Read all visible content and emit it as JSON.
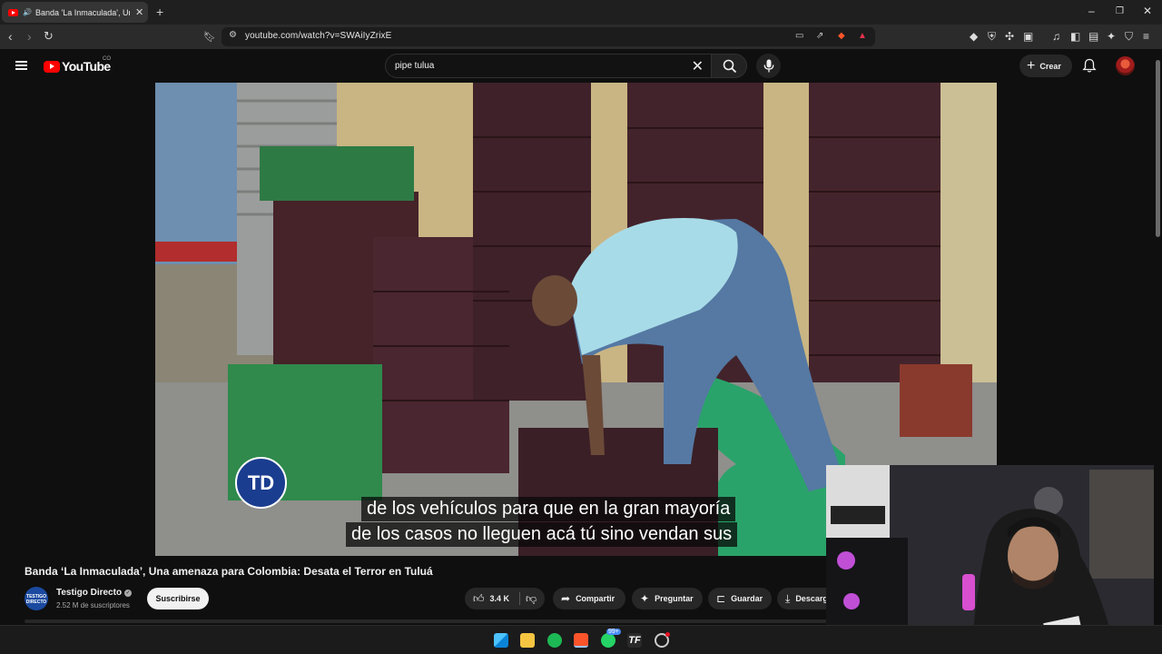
{
  "browser": {
    "tab_title": "Banda 'La Inmaculada', Una amenaza",
    "new_tab": "+",
    "url": "youtube.com/watch?v=SWAiIyZrixE",
    "window_controls": [
      "–",
      "❐",
      "✕"
    ]
  },
  "header": {
    "logo_text": "YouTube",
    "country_code": "CO",
    "search_query": "pipe tulua",
    "create_label": "Crear"
  },
  "video": {
    "channel_watermark": "TD",
    "subtitles": [
      "de los vehículos para que en la gran mayoría",
      "de los casos no lleguen acá tú sino vendan sus"
    ],
    "title": "Banda ‘La Inmaculada’, Una amenaza para Colombia: Desata el Terror en Tuluá"
  },
  "channel": {
    "avatar_text": "TESTIGO DIRECTO",
    "name": "Testigo Directo",
    "subscribers": "2.52 M de suscriptores",
    "subscribe_label": "Suscribirse"
  },
  "actions": {
    "likes": "3.4 K",
    "share": "Compartir",
    "ask": "Preguntar",
    "save": "Guardar",
    "download": "Descargar"
  },
  "taskbar": {
    "whatsapp_badge": "99+"
  },
  "colors": {
    "yt_red": "#ff0000",
    "bg": "#0f0f0f",
    "pill": "#272727",
    "td_blue": "#1b3d8f"
  }
}
